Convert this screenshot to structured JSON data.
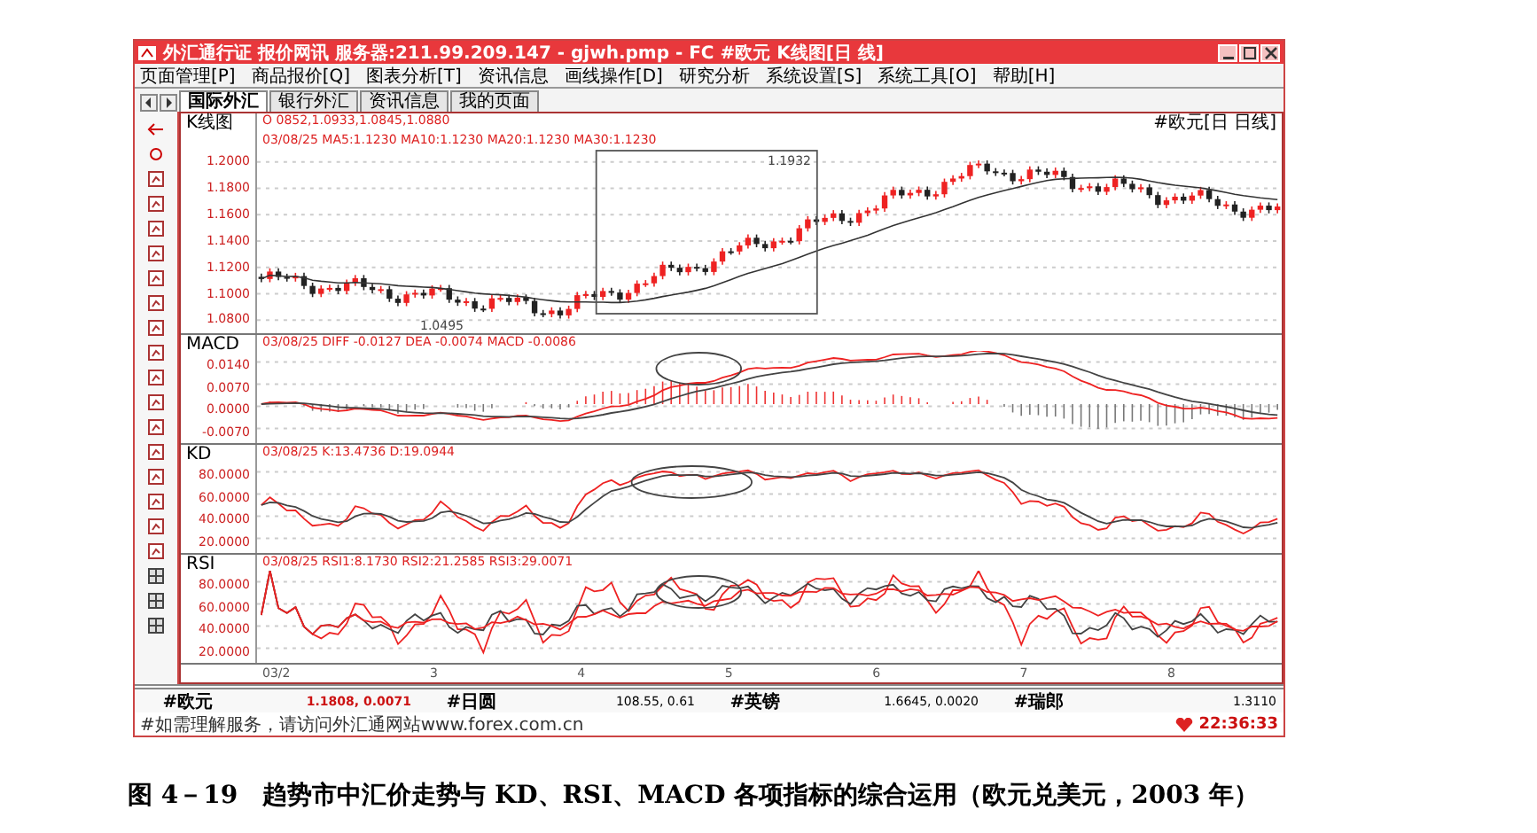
{
  "window": {
    "title": "外汇通行证  报价网讯  服务器:211.99.209.147  - gjwh.pmp - FC #欧元 K线图[日 线]"
  },
  "menu": [
    "页面管理[P]",
    "商品报价[Q]",
    "图表分析[T]",
    "资讯信息",
    "画线操作[D]",
    "研究分析",
    "系统设置[S]",
    "系统工具[O]",
    "帮助[H]"
  ],
  "tabs": [
    {
      "label": "国际外汇",
      "selected": true
    },
    {
      "label": "银行外汇",
      "selected": false
    },
    {
      "label": "资讯信息",
      "selected": false
    },
    {
      "label": "我的页面",
      "selected": false
    }
  ],
  "price_panel": {
    "name": "K线图",
    "ohlc": "O 0852,1.0933,1.0845,1.0880",
    "ma_line": "03/08/25 MA5:1.1230  MA10:1.1230  MA20:1.1230  MA30:1.1230",
    "symbol": "#欧元[日 日线]",
    "axis": [
      "1.2000",
      "1.1800",
      "1.1600",
      "1.1400",
      "1.1200",
      "1.1000",
      "1.0800"
    ],
    "high_label": "1.1932",
    "low_label": "1.0495"
  },
  "macd_panel": {
    "name": "MACD",
    "header": "03/08/25 DIFF -0.0127  DEA -0.0074  MACD -0.0086",
    "axis": [
      "0.0140",
      "0.0070",
      "0.0000",
      "-0.0070"
    ]
  },
  "kd_panel": {
    "name": "KD",
    "header": "03/08/25 K:13.4736  D:19.0944",
    "axis": [
      "80.0000",
      "60.0000",
      "40.0000",
      "20.0000"
    ]
  },
  "rsi_panel": {
    "name": "RSI",
    "header": "03/08/25 RSI1:8.1730  RSI2:21.2585  RSI3:29.0071",
    "axis": [
      "80.0000",
      "60.0000",
      "40.0000",
      "20.0000"
    ]
  },
  "x_axis": [
    "03/2",
    "3",
    "4",
    "5",
    "6",
    "7",
    "8"
  ],
  "quotes": [
    {
      "symbol": "#欧元",
      "value": "1.1808, 0.0071"
    },
    {
      "symbol": "#日圆",
      "value": "108.55, 0.61"
    },
    {
      "symbol": "#英镑",
      "value": "1.6645, 0.0020"
    },
    {
      "symbol": "#瑞郎",
      "value": "1.3110"
    }
  ],
  "footer": {
    "notice": "#如需理解服务，请访问外汇通网站www.forex.com.cn",
    "time": "22:36:33"
  },
  "caption": "图 4－19　趋势市中汇价走势与 KD、RSI、MACD 各项指标的综合运用（欧元兑美元，2003 年）"
}
